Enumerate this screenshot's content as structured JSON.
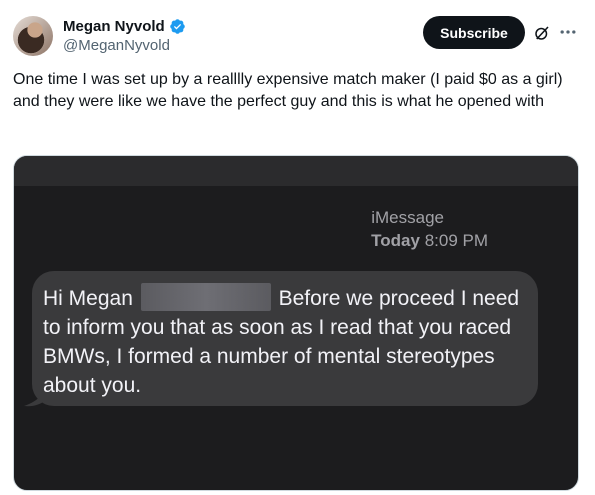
{
  "author": {
    "name": "Megan Nyvold",
    "handle": "@MeganNyvold",
    "verified": true
  },
  "actions": {
    "subscribe_label": "Subscribe",
    "grok_icon": "grok-icon",
    "more_icon": "more-icon"
  },
  "tweet": {
    "text": "One time I was set up by a realllly expensive match maker (I paid $0 as a girl) and they were like we have the perfect guy and this is what he opened with"
  },
  "imessage": {
    "service": "iMessage",
    "day": "Today",
    "time": "8:09 PM",
    "message_before": "Hi Megan",
    "message_after": "Before we proceed I need to inform you that as soon as I read that you raced BMWs, I formed a number of mental stereotypes about you."
  },
  "colors": {
    "verified_badge": "#1d9bf0",
    "subscribe_bg": "#0f1419",
    "bubble_bg": "#3a3a3c",
    "screen_bg": "#1c1c1e"
  }
}
